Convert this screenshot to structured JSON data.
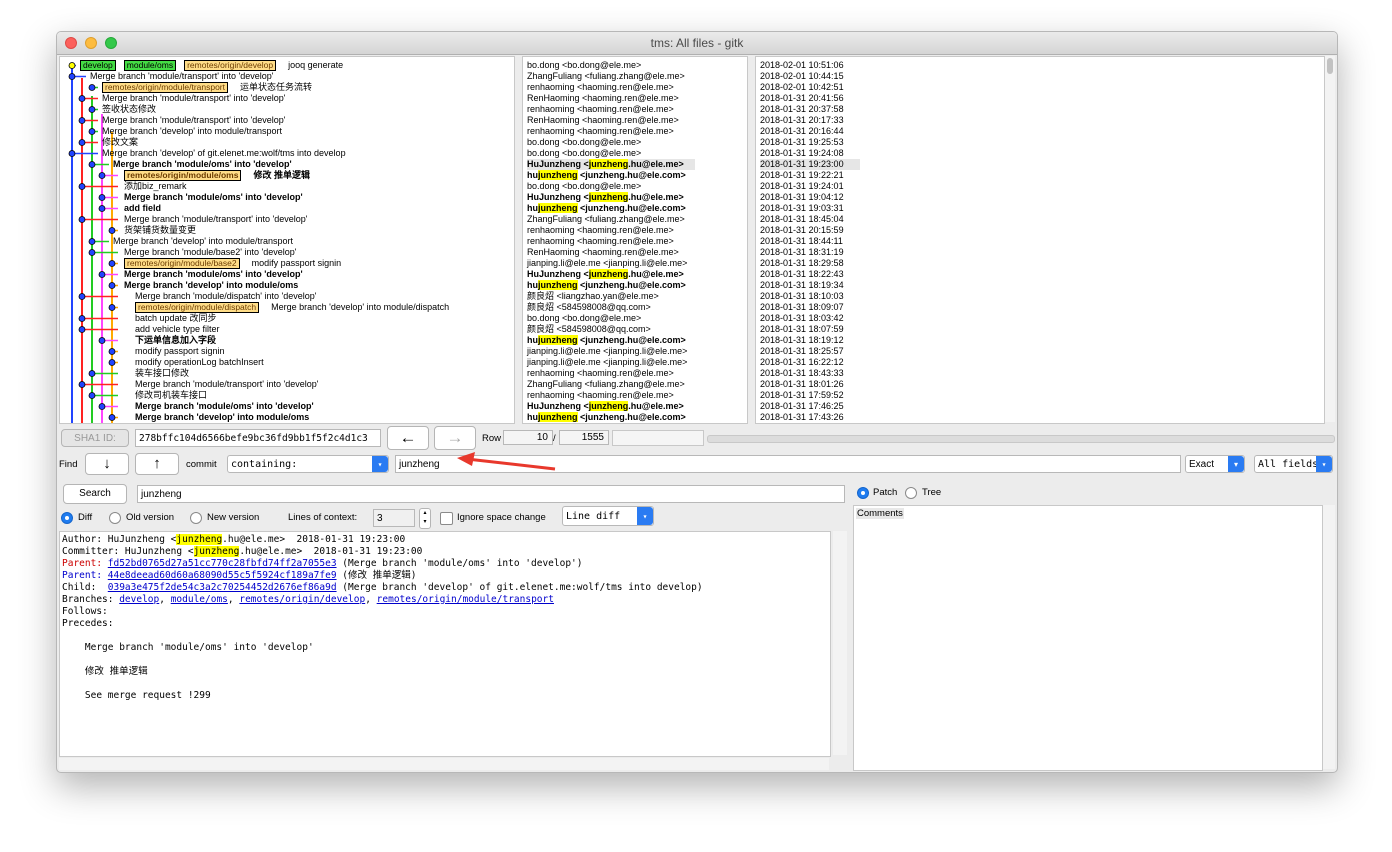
{
  "window": {
    "title": "tms: All files - gitk"
  },
  "colors": {
    "branch_local": "#44dd44",
    "branch_remote": "#ffdd88",
    "highlight": "#ffff00",
    "radio_accent": "#1f7cf0",
    "arrow_annotation": "#e8382c"
  },
  "commits": [
    {
      "msg": "jooq generate",
      "author": "bo.dong <bo.dong@ele.me>",
      "date": "2018-02-01 10:51:06",
      "refs": [
        "develop",
        "module/oms",
        "remotes/origin/develop"
      ]
    },
    {
      "msg": "Merge branch 'module/transport' into 'develop'",
      "author": "ZhangFuliang <fuliang.zhang@ele.me>",
      "date": "2018-02-01 10:44:15"
    },
    {
      "msg": "运单状态任务流转",
      "author": "renhaoming <haoming.ren@ele.me>",
      "date": "2018-02-01 10:42:51",
      "refs": [
        "remotes/origin/module/transport"
      ]
    },
    {
      "msg": "Merge branch 'module/transport' into 'develop'",
      "author": "RenHaoming <haoming.ren@ele.me>",
      "date": "2018-01-31 20:41:56"
    },
    {
      "msg": "签收状态修改",
      "author": "renhaoming <haoming.ren@ele.me>",
      "date": "2018-01-31 20:37:58"
    },
    {
      "msg": "Merge branch 'module/transport' into 'develop'",
      "author": "RenHaoming <haoming.ren@ele.me>",
      "date": "2018-01-31 20:17:33"
    },
    {
      "msg": "Merge branch 'develop' into module/transport",
      "author": "renhaoming <haoming.ren@ele.me>",
      "date": "2018-01-31 20:16:44"
    },
    {
      "msg": "修改文案",
      "author": "bo.dong <bo.dong@ele.me>",
      "date": "2018-01-31 19:25:53"
    },
    {
      "msg": "Merge branch 'develop' of git.elenet.me:wolf/tms into develop",
      "author": "bo.dong <bo.dong@ele.me>",
      "date": "2018-01-31 19:24:08"
    },
    {
      "msg": "Merge branch 'module/oms' into 'develop'",
      "author_pre": "HuJunzheng <",
      "author_hl": "junzheng",
      "author_post": ".hu@ele.me>",
      "date": "2018-01-31 19:23:00",
      "bold": true,
      "selected": true
    },
    {
      "msg": "修改 推单逻辑",
      "author_pre": "hu",
      "author_hl": "junzheng",
      "author_post": " <junzheng.hu@ele.com>",
      "date": "2018-01-31 19:22:21",
      "bold": true,
      "refs": [
        "remotes/origin/module/oms"
      ]
    },
    {
      "msg": "添加biz_remark",
      "author": "bo.dong <bo.dong@ele.me>",
      "date": "2018-01-31 19:24:01"
    },
    {
      "msg": "Merge branch 'module/oms' into 'develop'",
      "author_pre": "HuJunzheng <",
      "author_hl": "junzheng",
      "author_post": ".hu@ele.me>",
      "date": "2018-01-31 19:04:12",
      "bold": true
    },
    {
      "msg": "add field",
      "author_pre": "hu",
      "author_hl": "junzheng",
      "author_post": " <junzheng.hu@ele.com>",
      "date": "2018-01-31 19:03:31",
      "bold": true
    },
    {
      "msg": "Merge branch 'module/transport' into 'develop'",
      "author": "ZhangFuliang <fuliang.zhang@ele.me>",
      "date": "2018-01-31 18:45:04"
    },
    {
      "msg": "货架铺货数量变更",
      "author": "renhaoming <haoming.ren@ele.me>",
      "date": "2018-01-31 20:15:59"
    },
    {
      "msg": "Merge branch 'develop' into module/transport",
      "author": "renhaoming <haoming.ren@ele.me>",
      "date": "2018-01-31 18:44:11"
    },
    {
      "msg": "Merge branch 'module/base2' into 'develop'",
      "author": "RenHaoming <haoming.ren@ele.me>",
      "date": "2018-01-31 18:31:19"
    },
    {
      "msg": "modify passport signin",
      "author": "jianping.li@ele.me <jianping.li@ele.me>",
      "date": "2018-01-31 18:29:58",
      "refs": [
        "remotes/origin/module/base2"
      ]
    },
    {
      "msg": "Merge branch 'module/oms' into 'develop'",
      "author_pre": "HuJunzheng <",
      "author_hl": "junzheng",
      "author_post": ".hu@ele.me>",
      "date": "2018-01-31 18:22:43",
      "bold": true
    },
    {
      "msg": "Merge branch 'develop' into module/oms",
      "author_pre": "hu",
      "author_hl": "junzheng",
      "author_post": " <junzheng.hu@ele.com>",
      "date": "2018-01-31 18:19:34",
      "bold": true
    },
    {
      "msg": "Merge branch 'module/dispatch' into 'develop'",
      "author": "颜良炤 <liangzhao.yan@ele.me>",
      "date": "2018-01-31 18:10:03"
    },
    {
      "msg": "Merge branch 'develop' into module/dispatch",
      "author": "颜良炤 <584598008@qq.com>",
      "date": "2018-01-31 18:09:07",
      "refs": [
        "remotes/origin/module/dispatch"
      ]
    },
    {
      "msg": "batch update 改同步",
      "author": "bo.dong <bo.dong@ele.me>",
      "date": "2018-01-31 18:03:42"
    },
    {
      "msg": "add vehicle type filter",
      "author": "颜良炤 <584598008@qq.com>",
      "date": "2018-01-31 18:07:59"
    },
    {
      "msg": "下运单信息加入字段",
      "author_pre": "hu",
      "author_hl": "junzheng",
      "author_post": " <junzheng.hu@ele.com>",
      "date": "2018-01-31 18:19:12",
      "bold": true
    },
    {
      "msg": "modify passport signin",
      "author": "jianping.li@ele.me <jianping.li@ele.me>",
      "date": "2018-01-31 18:25:57"
    },
    {
      "msg": "modify operationLog batchInsert",
      "author": "jianping.li@ele.me <jianping.li@ele.me>",
      "date": "2018-01-31 16:22:12"
    },
    {
      "msg": "装车接口修改",
      "author": "renhaoming <haoming.ren@ele.me>",
      "date": "2018-01-31 18:43:33"
    },
    {
      "msg": "Merge branch 'module/transport' into 'develop'",
      "author": "ZhangFuliang <fuliang.zhang@ele.me>",
      "date": "2018-01-31 18:01:26"
    },
    {
      "msg": "修改司机装车接口",
      "author": "renhaoming <haoming.ren@ele.me>",
      "date": "2018-01-31 17:59:52"
    },
    {
      "msg": "Merge branch 'module/oms' into 'develop'",
      "author_pre": "HuJunzheng <",
      "author_hl": "junzheng",
      "author_post": ".hu@ele.me>",
      "date": "2018-01-31 17:46:25",
      "bold": true
    },
    {
      "msg": "Merge branch 'develop' into module/oms",
      "author_pre": "hu",
      "author_hl": "junzheng",
      "author_post": " <junzheng.hu@ele.com>",
      "date": "2018-01-31 17:43:26",
      "bold": true
    }
  ],
  "toolbar": {
    "sha_label": "SHA1 ID:",
    "sha_value": "278bffc104d6566befe9bc36fd9bb1f5f2c4d1c3",
    "back_arrow": "←",
    "fwd_arrow": "→",
    "row_label": "Row",
    "row_value": "10",
    "row_sep": "/",
    "row_total": "1555"
  },
  "find": {
    "label": "Find",
    "down_arrow": "↓",
    "up_arrow": "↑",
    "commit_label": "commit",
    "containing": "containing:",
    "query": "junzheng",
    "exact": "Exact",
    "all_fields": "All fields"
  },
  "search": {
    "button": "Search",
    "query": "junzheng"
  },
  "diff_options": {
    "diff": "Diff",
    "old_version": "Old version",
    "new_version": "New version",
    "context_label": "Lines of context:",
    "context_value": "3",
    "ignore_space": "Ignore space change",
    "line_diff": "Line diff"
  },
  "right_panel": {
    "patch": "Patch",
    "tree": "Tree",
    "comments": "Comments"
  },
  "details": {
    "author_label": "Author: ",
    "author_pre": "HuJunzheng <",
    "author_hl": "junzheng",
    "author_post": ".hu@ele.me>  2018-01-31 19:23:00",
    "committer_label": "Committer: ",
    "committer_pre": "HuJunzheng <",
    "committer_hl": "junzheng",
    "committer_post": ".hu@ele.me>  2018-01-31 19:23:00",
    "parent1_label": "Parent: ",
    "parent1_sha": "fd52bd0765d27a51cc770c28fbfd74ff2a7055e3",
    "parent1_msg": " (Merge branch 'module/oms' into 'develop')",
    "parent2_label": "Parent: ",
    "parent2_sha": "44e8deead60d60a68090d55c5f5924cf189a7fe9",
    "parent2_msg": " (修改 推单逻辑)",
    "child_label": "Child:  ",
    "child_sha": "039a3e475f2de54c3a2c70254452d2676ef86a9d",
    "child_msg": " (Merge branch 'develop' of git.elenet.me:wolf/tms into develop)",
    "branches_label": "Branches: ",
    "branches": [
      "develop",
      "module/oms",
      "remotes/origin/develop",
      "remotes/origin/module/transport"
    ],
    "follows_label": "Follows:",
    "precedes_label": "Precedes:",
    "body_line1": "    Merge branch 'module/oms' into 'develop'",
    "body_line2": "    修改 推单逻辑",
    "body_line3": "    See merge request !299"
  }
}
